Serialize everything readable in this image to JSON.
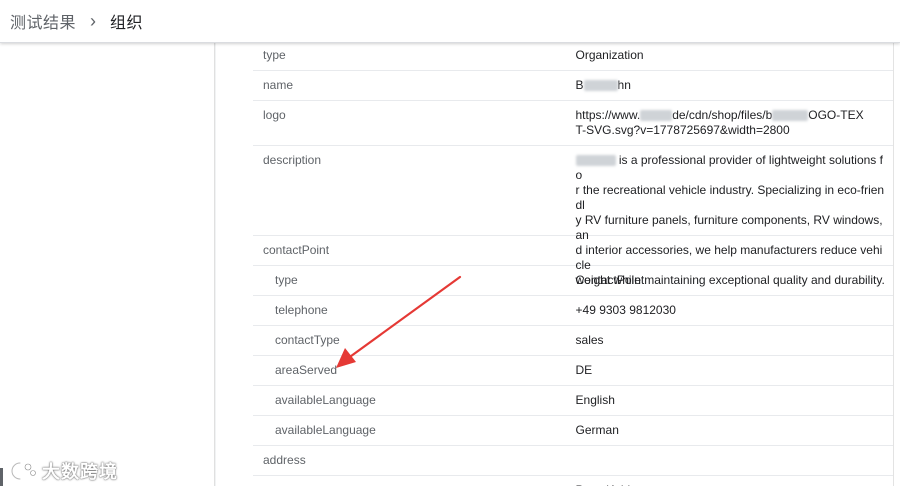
{
  "breadcrumb": {
    "root": "测试结果",
    "separator": "›",
    "current": "组织"
  },
  "rows": [
    {
      "key": "type",
      "value": "Organization"
    },
    {
      "key": "name",
      "value_prefix": "B",
      "value_suffix": "hn"
    },
    {
      "key": "logo",
      "value_line1_a": "https://www.",
      "value_line1_b": "de/cdn/shop/files/b",
      "value_line1_c": "OGO-TEX",
      "value_line2": "T-SVG.svg?v=1778725697&width=2800"
    },
    {
      "key": "description",
      "value_lines": [
        " is a professional provider of lightweight solutions fo",
        "r the recreational vehicle industry. Specializing in eco-friendl",
        "y RV furniture panels, furniture components, RV windows, an",
        "d interior accessories, we help manufacturers reduce vehicle",
        "weight while maintaining exceptional quality and durability."
      ]
    },
    {
      "key": "contactPoint",
      "value": ""
    },
    {
      "key": "type",
      "value": "ContactPoint"
    },
    {
      "key": "telephone",
      "value": "+49 9303 9812030"
    },
    {
      "key": "contactType",
      "value": "sales"
    },
    {
      "key": "areaServed",
      "value": "DE"
    },
    {
      "key": "availableLanguage",
      "value": "English"
    },
    {
      "key": "availableLanguage",
      "value": "German"
    },
    {
      "key": "address",
      "value": ""
    },
    {
      "key": "type",
      "value": "PostalAddress"
    }
  ],
  "annotation": {
    "color": "#e53935"
  },
  "watermark": {
    "text": "大数跨境"
  }
}
